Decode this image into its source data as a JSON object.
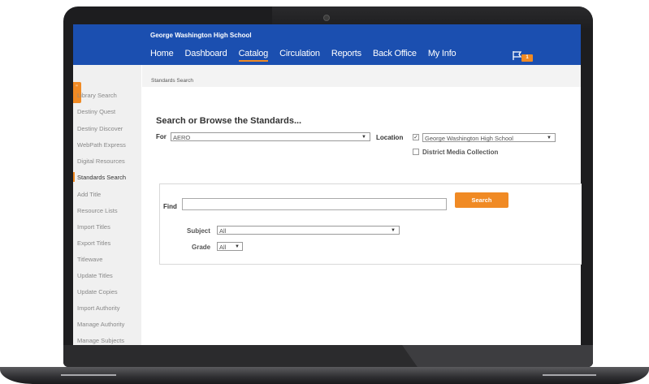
{
  "header": {
    "school_name": "George Washington High School",
    "nav_items": [
      "Home",
      "Dashboard",
      "Catalog",
      "Circulation",
      "Reports",
      "Back Office",
      "My Info"
    ],
    "active_nav": "Catalog",
    "notification_count": "1",
    "brand_color": "#1b4fb0",
    "accent_color": "#f08a24"
  },
  "sidebar": {
    "items": [
      "Library Search",
      "Destiny Quest",
      "Destiny Discover",
      "WebPath Express",
      "Digital Resources",
      "Standards Search",
      "Add Title",
      "Resource Lists",
      "Import Titles",
      "Export Titles",
      "Titlewave",
      "Update Titles",
      "Update Copies",
      "Import Authority",
      "Manage Authority",
      "Manage Subjects"
    ],
    "selected": "Standards Search"
  },
  "breadcrumb": "Standards Search",
  "search_form": {
    "heading": "Search or Browse the Standards...",
    "for_label": "For",
    "for_value": "AERO",
    "location_label": "Location",
    "location_value": "George Washington High School",
    "district_label": "District Media Collection"
  },
  "find_form": {
    "find_label": "Find",
    "find_value": "",
    "search_button": "Search",
    "subject_label": "Subject",
    "subject_value": "All",
    "grade_label": "Grade",
    "grade_value": "All"
  }
}
